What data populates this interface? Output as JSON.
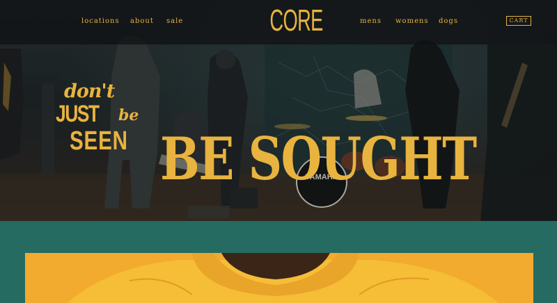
{
  "nav": {
    "left_links": [
      "locations",
      "about",
      "sale"
    ],
    "logo": "CORE",
    "right_links": [
      "mens",
      "womens",
      "dogs"
    ],
    "cart_label": "CART"
  },
  "hero": {
    "tagline": {
      "line1": "don't",
      "line2_just": "JUST",
      "line2_be": "be",
      "line3": "SEEN"
    },
    "headline": "BE SOUGHT",
    "drum_brand": "YAMAHA"
  },
  "colors": {
    "accent": "#e8b33e",
    "teal_background": "#256b62",
    "promo_yellow": "#f1a92d",
    "nav_background": "#0e1012"
  }
}
